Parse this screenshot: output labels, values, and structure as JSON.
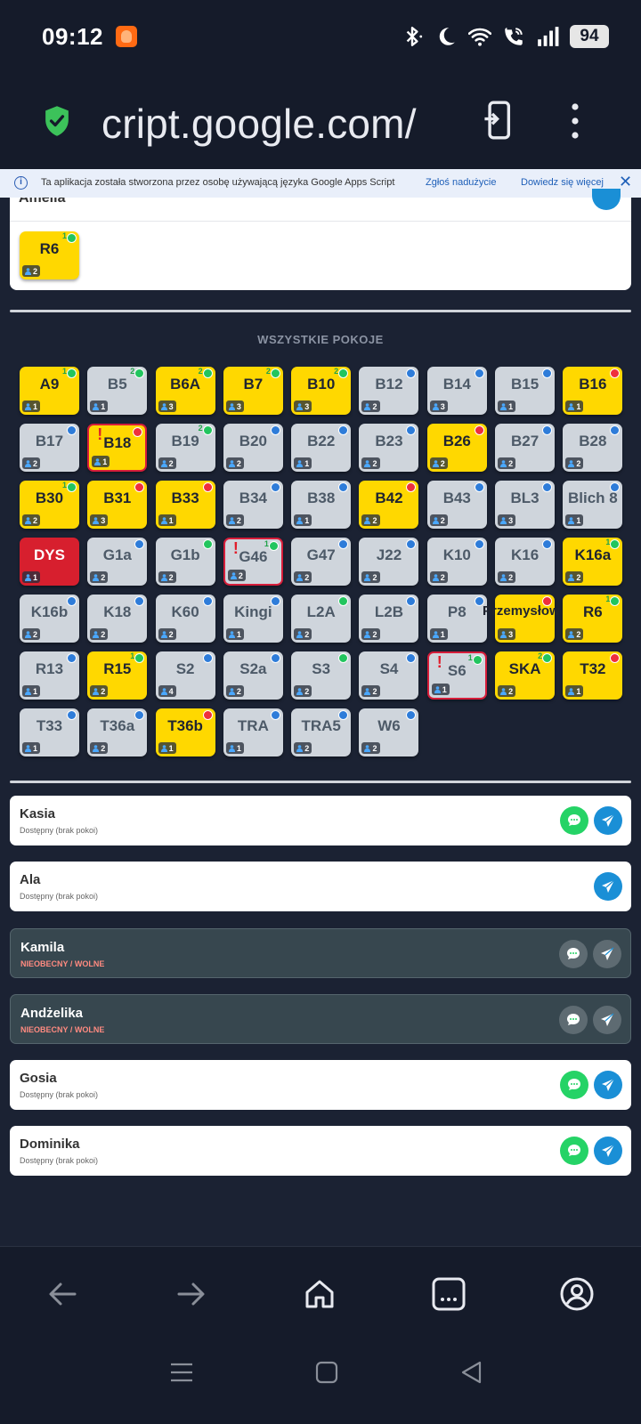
{
  "status_bar": {
    "time": "09:12",
    "battery": "94",
    "icons": [
      "bluetooth-icon",
      "moon-icon",
      "wifi-icon",
      "wifi-call-icon",
      "signal-icon"
    ]
  },
  "browser": {
    "url": "cript.google.com/",
    "icons": [
      "shield-icon",
      "tabs-icon",
      "more-icon"
    ]
  },
  "banner": {
    "text": "Ta aplikacja została stworzona przez osobę używającą języka Google Apps Script",
    "report": "Zgłoś nadużycie",
    "learn_more": "Dowiedz się więcej",
    "close": "✕"
  },
  "top_card": {
    "cut_name": "Amelia",
    "room": {
      "name": "R6",
      "count": "2",
      "color": "yellow",
      "dot": "green",
      "tick": "1"
    }
  },
  "section_title": "WSZYSTKIE POKOJE",
  "rooms": [
    {
      "name": "A9",
      "count": "1",
      "color": "yellow",
      "dot": "green",
      "tick": "1"
    },
    {
      "name": "B5",
      "count": "1",
      "color": "grey",
      "dot": "green",
      "tick": "2"
    },
    {
      "name": "B6A",
      "count": "3",
      "color": "yellow",
      "dot": "green",
      "tick": "2"
    },
    {
      "name": "B7",
      "count": "3",
      "color": "yellow",
      "dot": "green",
      "tick": "2"
    },
    {
      "name": "B10",
      "count": "3",
      "color": "yellow",
      "dot": "green",
      "tick": "2"
    },
    {
      "name": "B12",
      "count": "2",
      "color": "grey",
      "dot": "blue"
    },
    {
      "name": "B14",
      "count": "3",
      "color": "grey",
      "dot": "blue"
    },
    {
      "name": "B15",
      "count": "1",
      "color": "grey",
      "dot": "blue"
    },
    {
      "name": "B16",
      "count": "1",
      "color": "yellow",
      "dot": "red"
    },
    {
      "name": "B17",
      "count": "2",
      "color": "grey",
      "dot": "blue"
    },
    {
      "name": "B18",
      "count": "1",
      "color": "yellow",
      "dot": "red",
      "alert": true
    },
    {
      "name": "B19",
      "count": "2",
      "color": "grey",
      "dot": "green",
      "tick": "2"
    },
    {
      "name": "B20",
      "count": "2",
      "color": "grey",
      "dot": "blue"
    },
    {
      "name": "B22",
      "count": "1",
      "color": "grey",
      "dot": "blue"
    },
    {
      "name": "B23",
      "count": "2",
      "color": "grey",
      "dot": "blue"
    },
    {
      "name": "B26",
      "count": "2",
      "color": "yellow",
      "dot": "red"
    },
    {
      "name": "B27",
      "count": "2",
      "color": "grey",
      "dot": "blue"
    },
    {
      "name": "B28",
      "count": "2",
      "color": "grey",
      "dot": "blue"
    },
    {
      "name": "B30",
      "count": "2",
      "color": "yellow",
      "dot": "green",
      "tick": "1"
    },
    {
      "name": "B31",
      "count": "3",
      "color": "yellow",
      "dot": "red"
    },
    {
      "name": "B33",
      "count": "1",
      "color": "yellow",
      "dot": "red"
    },
    {
      "name": "B34",
      "count": "2",
      "color": "grey",
      "dot": "blue"
    },
    {
      "name": "B38",
      "count": "1",
      "color": "grey",
      "dot": "blue"
    },
    {
      "name": "B42",
      "count": "2",
      "color": "yellow",
      "dot": "red"
    },
    {
      "name": "B43",
      "count": "2",
      "color": "grey",
      "dot": "blue"
    },
    {
      "name": "BL3",
      "count": "3",
      "color": "grey",
      "dot": "blue"
    },
    {
      "name": "Blich 8",
      "count": "1",
      "color": "grey",
      "dot": "blue"
    },
    {
      "name": "DYS",
      "count": "1",
      "color": "red",
      "dot": "none"
    },
    {
      "name": "G1a",
      "count": "2",
      "color": "grey",
      "dot": "blue"
    },
    {
      "name": "G1b",
      "count": "2",
      "color": "grey",
      "dot": "green"
    },
    {
      "name": "G46",
      "count": "2",
      "color": "grey",
      "dot": "green",
      "tick": "1",
      "alert": true
    },
    {
      "name": "G47",
      "count": "2",
      "color": "grey",
      "dot": "blue"
    },
    {
      "name": "J22",
      "count": "2",
      "color": "grey",
      "dot": "blue"
    },
    {
      "name": "K10",
      "count": "2",
      "color": "grey",
      "dot": "blue"
    },
    {
      "name": "K16",
      "count": "2",
      "color": "grey",
      "dot": "blue"
    },
    {
      "name": "K16a",
      "count": "2",
      "color": "yellow",
      "dot": "green",
      "tick": "1"
    },
    {
      "name": "K16b",
      "count": "2",
      "color": "grey",
      "dot": "blue"
    },
    {
      "name": "K18",
      "count": "2",
      "color": "grey",
      "dot": "blue"
    },
    {
      "name": "K60",
      "count": "2",
      "color": "grey",
      "dot": "blue"
    },
    {
      "name": "Kingi",
      "count": "1",
      "color": "grey",
      "dot": "blue"
    },
    {
      "name": "L2A",
      "count": "2",
      "color": "grey",
      "dot": "green"
    },
    {
      "name": "L2B",
      "count": "2",
      "color": "grey",
      "dot": "blue"
    },
    {
      "name": "P8",
      "count": "1",
      "color": "grey",
      "dot": "blue"
    },
    {
      "name": "Przemysłowa",
      "count": "3",
      "color": "yellow",
      "dot": "red",
      "wide": true
    },
    {
      "name": "R6",
      "count": "2",
      "color": "yellow",
      "dot": "green",
      "tick": "1"
    },
    {
      "name": "R13",
      "count": "1",
      "color": "grey",
      "dot": "blue"
    },
    {
      "name": "R15",
      "count": "2",
      "color": "yellow",
      "dot": "green",
      "tick": "1"
    },
    {
      "name": "S2",
      "count": "4",
      "color": "grey",
      "dot": "blue"
    },
    {
      "name": "S2a",
      "count": "2",
      "color": "grey",
      "dot": "blue"
    },
    {
      "name": "S3",
      "count": "2",
      "color": "grey",
      "dot": "green"
    },
    {
      "name": "S4",
      "count": "2",
      "color": "grey",
      "dot": "blue"
    },
    {
      "name": "S6",
      "count": "1",
      "color": "grey",
      "dot": "green",
      "tick": "1",
      "alert": true
    },
    {
      "name": "SKA",
      "count": "2",
      "color": "yellow",
      "dot": "green",
      "tick": "2"
    },
    {
      "name": "T32",
      "count": "1",
      "color": "yellow",
      "dot": "red"
    },
    {
      "name": "T33",
      "count": "1",
      "color": "grey",
      "dot": "blue"
    },
    {
      "name": "T36a",
      "count": "2",
      "color": "grey",
      "dot": "blue"
    },
    {
      "name": "T36b",
      "count": "1",
      "color": "yellow",
      "dot": "red"
    },
    {
      "name": "TRA",
      "count": "1",
      "color": "grey",
      "dot": "blue"
    },
    {
      "name": "TRA5",
      "count": "2",
      "color": "grey",
      "dot": "blue"
    },
    {
      "name": "W6",
      "count": "2",
      "color": "grey",
      "dot": "blue"
    }
  ],
  "people": [
    {
      "name": "Kasia",
      "status": "Dostępny (brak pokoi)",
      "absent": false,
      "chat": true
    },
    {
      "name": "Ala",
      "status": "Dostępny (brak pokoi)",
      "absent": false,
      "chat": false
    },
    {
      "name": "Kamila",
      "status": "NIEOBECNY / WOLNE",
      "absent": true,
      "chat": true
    },
    {
      "name": "Andżelika",
      "status": "NIEOBECNY / WOLNE",
      "absent": true,
      "chat": true
    },
    {
      "name": "Gosia",
      "status": "Dostępny (brak pokoi)",
      "absent": false,
      "chat": true
    },
    {
      "name": "Dominika",
      "status": "Dostępny (brak pokoi)",
      "absent": false,
      "chat": true
    }
  ],
  "colors": {
    "room_yellow": "#ffd800",
    "room_grey": "#cfd5dc",
    "room_red": "#d71f2e",
    "dot_blue": "#2e7cd9",
    "dot_green": "#22c55e",
    "dot_red": "#ef2f3c",
    "chat_green": "#25d366",
    "send_blue": "#1a8fd6",
    "absent_bg": "#37474f"
  },
  "bottom_nav": [
    "back-arrow-icon",
    "forward-arrow-icon",
    "home-icon",
    "tabs-overview-icon",
    "profile-icon"
  ],
  "system_nav": [
    "recents-icon",
    "home-square-icon",
    "back-triangle-icon"
  ]
}
